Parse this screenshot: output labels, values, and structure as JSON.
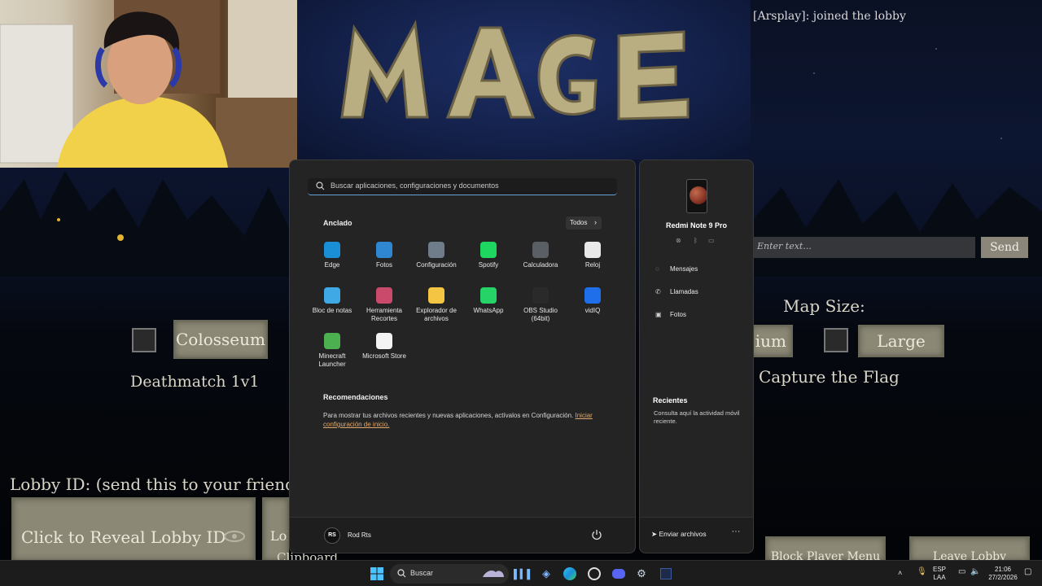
{
  "game": {
    "chat_message": "[Arsplay]: joined the lobby",
    "chat_placeholder": "Enter text...",
    "send_label": "Send",
    "map_size_label": "Map Size:",
    "medium_partial": "ium",
    "large_label": "Large",
    "colosseum_label": "Colosseum",
    "deathmatch_label": "Deathmatch 1v1",
    "ctf_label": "Capture the Flag",
    "lobby_id_label": "Lobby ID: (send this to your friends",
    "reveal_lobby_label": "Click to Reveal Lobby ID",
    "copy_partial_1": "Lol",
    "copy_partial_2": "Clipboard",
    "block_player_label": "Block Player Menu",
    "leave_lobby_label": "Leave Lobby"
  },
  "start_menu": {
    "search_placeholder": "Buscar aplicaciones, configuraciones y documentos",
    "pinned_title": "Anclado",
    "all_label": "Todos",
    "apps": [
      {
        "label": "Edge",
        "icon": "edge-icon",
        "color": "#1b8fd6"
      },
      {
        "label": "Fotos",
        "icon": "photos-icon",
        "color": "#2f87d1"
      },
      {
        "label": "Configuración",
        "icon": "settings-icon",
        "color": "#6f7c8a"
      },
      {
        "label": "Spotify",
        "icon": "spotify-icon",
        "color": "#1ed760"
      },
      {
        "label": "Calculadora",
        "icon": "calculator-icon",
        "color": "#5a5f66"
      },
      {
        "label": "Reloj",
        "icon": "clock-icon",
        "color": "#e8e8e8"
      },
      {
        "label": "Bloc de notas",
        "icon": "notepad-icon",
        "color": "#3fa9e6"
      },
      {
        "label": "Herramienta Recortes",
        "icon": "snipping-tool-icon",
        "color": "#c94a6a"
      },
      {
        "label": "Explorador de archivos",
        "icon": "file-explorer-icon",
        "color": "#f4c542"
      },
      {
        "label": "WhatsApp",
        "icon": "whatsapp-icon",
        "color": "#25d366"
      },
      {
        "label": "OBS Studio (64bit)",
        "icon": "obs-icon",
        "color": "#2a2a2a"
      },
      {
        "label": "vidIQ",
        "icon": "vidiq-icon",
        "color": "#1f6feb"
      },
      {
        "label": "Minecraft Launcher",
        "icon": "minecraft-icon",
        "color": "#4caf50"
      },
      {
        "label": "Microsoft Store",
        "icon": "store-icon",
        "color": "#f3f3f3"
      }
    ],
    "recommendations_title": "Recomendaciones",
    "recommendations_text": "Para mostrar tus archivos recientes y nuevas aplicaciones, actívalos en Configuración.",
    "recommendations_link": "Iniciar configuración de inicio.",
    "user_initials": "RS",
    "user_name": "Rod Rts"
  },
  "phone_link": {
    "device_name": "Redmi Note 9 Pro",
    "items": [
      {
        "label": "Mensajes",
        "icon": "messages-icon"
      },
      {
        "label": "Llamadas",
        "icon": "phone-icon"
      },
      {
        "label": "Fotos",
        "icon": "photos-icon"
      }
    ],
    "recent_title": "Recientes",
    "recent_text": "Consulta aquí la actividad móvil reciente.",
    "send_files_label": "Enviar archivos",
    "more_label": "···"
  },
  "taskbar": {
    "search_placeholder": "Buscar",
    "lang_line1": "ESP",
    "lang_line2": "LAA",
    "time": "21:06",
    "date": "27/2/2026",
    "accent": "#4cc2ff"
  }
}
